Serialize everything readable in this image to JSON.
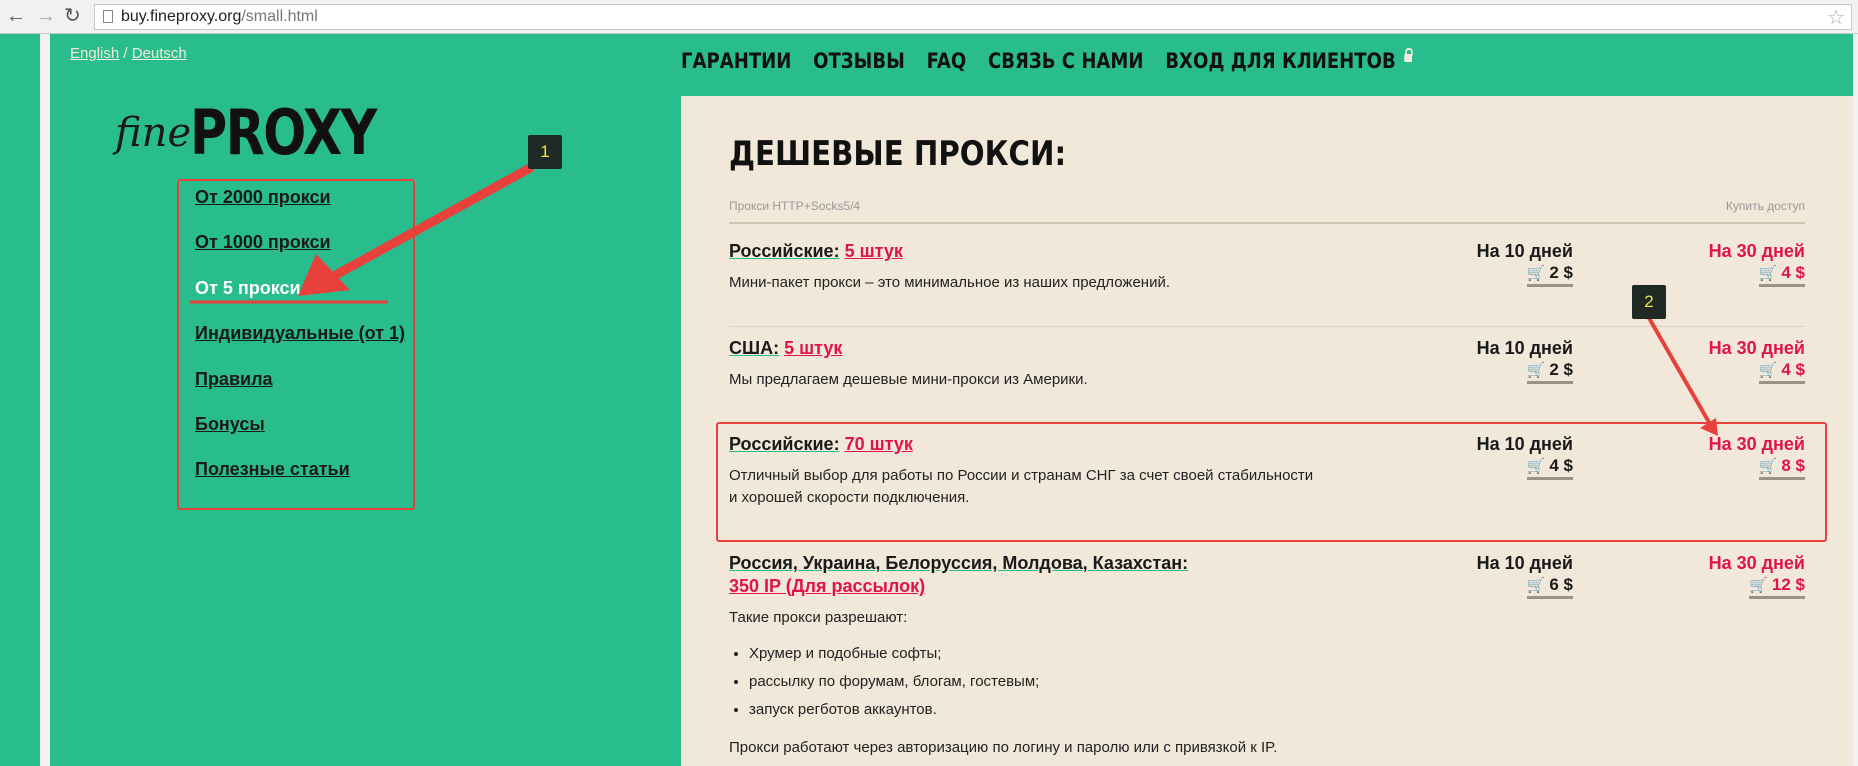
{
  "browser": {
    "url_host": "buy.fineproxy.org",
    "url_path": "/small.html"
  },
  "lang": {
    "english": "English",
    "separator": "/",
    "deutsch": "Deutsch"
  },
  "logo": {
    "fine": "fine",
    "proxy": "PROXY"
  },
  "sidebar": {
    "items": [
      {
        "label": "От 2000 прокси"
      },
      {
        "label": "От 1000 прокси"
      },
      {
        "label": "От 5 прокси"
      },
      {
        "label": "Индивидуальные (от 1)"
      },
      {
        "label": "Правила"
      },
      {
        "label": "Бонусы"
      },
      {
        "label": "Полезные статьи"
      }
    ],
    "active_index": 2
  },
  "nav": {
    "items": [
      "ГАРАНТИИ",
      "ОТЗЫВЫ",
      "FAQ",
      "СВЯЗЬ С НАМИ",
      "ВХОД ДЛЯ КЛИЕНТОВ"
    ]
  },
  "main": {
    "heading": "ДЕШЕВЫЕ ПРОКСИ:",
    "col_left": "Прокси HTTP+Socks5/4",
    "col_right": "Купить доступ",
    "offers": [
      {
        "title": "Российские:",
        "qty": "5 штук",
        "desc": "Мини-пакет прокси – это минимальное из наших предложений.",
        "p10_label": "На 10 дней",
        "p10_value": "2 $",
        "p30_label": "На 30 дней",
        "p30_value": "4 $"
      },
      {
        "title": "США:",
        "qty": "5 штук",
        "desc": "Мы предлагаем дешевые мини-прокси из Америки.",
        "p10_label": "На 10 дней",
        "p10_value": "2 $",
        "p30_label": "На 30 дней",
        "p30_value": "4 $"
      },
      {
        "title": "Российские:",
        "qty": "70 штук",
        "desc1": "Отличный выбор для работы по России и странам СНГ за счет своей стабильности",
        "desc2": "и хорошей скорости подключения.",
        "p10_label": "На 10 дней",
        "p10_value": "4 $",
        "p30_label": "На 30 дней",
        "p30_value": "8 $"
      },
      {
        "title": "Россия, Украина, Белоруссия, Молдова, Казахстан:",
        "qty": "350  IP (Для рассылок)",
        "desc": "Такие прокси разрешают:",
        "bullets": [
          "Хрумер и подобные софты;",
          "рассылку по форумам, блогам, гостевым;",
          "запуск регботов аккаунтов."
        ],
        "footnote": "Прокси работают через авторизацию по логину и паролю или с привязкой к IP.",
        "p10_label": "На 10 дней",
        "p10_value": "6 $",
        "p30_label": "На 30 дней",
        "p30_value": "12 $"
      }
    ]
  },
  "annotations": {
    "badge1": "1",
    "badge2": "2"
  },
  "colors": {
    "brand_green": "#29bc8d",
    "content_bg": "#f1e8da",
    "accent_red": "#e0134c",
    "annotation_red": "#e8413b"
  },
  "icons": {
    "back": "arrow-left-icon",
    "forward": "arrow-right-icon",
    "reload": "reload-icon",
    "star": "star-icon",
    "lock": "lock-icon",
    "cart": "cart-icon"
  }
}
